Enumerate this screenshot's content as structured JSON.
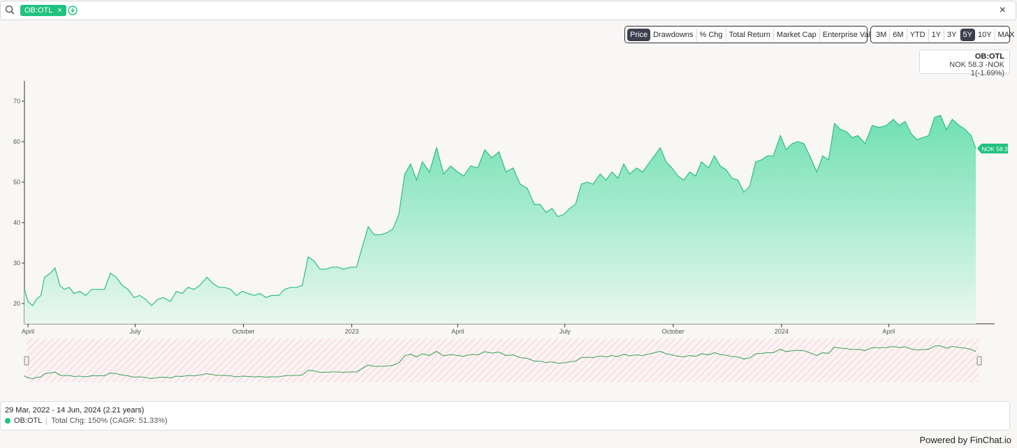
{
  "search": {
    "ticker_chip": "OB:OTL",
    "chip_close": "×",
    "close_symbol": "×"
  },
  "toolbar": {
    "metrics": [
      "Price",
      "Drawdowns",
      "% Chg",
      "Total Return",
      "Market Cap",
      "Enterprise Value"
    ],
    "active_metric": "Price",
    "ranges": [
      "3M",
      "6M",
      "YTD",
      "1Y",
      "3Y",
      "5Y",
      "10Y",
      "MAX"
    ],
    "active_range": "5Y"
  },
  "tooltip": {
    "ticker": "OB:OTL",
    "price_change": "NOK 58.3  -NOK 1(-1.69%)"
  },
  "footer": {
    "date_range": "29 Mar, 2022 - 14 Jun, 2024 (2.21 years)",
    "ticker": "OB:OTL",
    "total_change": "Total Chg: 150% (CAGR: 51.33%)"
  },
  "powered_by": "Powered by FinChat.io",
  "colors": {
    "accent": "#20c27f",
    "line": "#2dbf80",
    "area_top": "#6fe0b3",
    "area_bottom": "#e9f7f0",
    "navigator_hatch": "#f3c5cc"
  },
  "chart_data": {
    "type": "area",
    "series": [
      {
        "name": "OB:OTL"
      }
    ],
    "ylim": [
      15,
      75
    ],
    "yticks": [
      20,
      30,
      40,
      50,
      60,
      70
    ],
    "xlim": [
      "2022-03-29",
      "2024-06-14"
    ],
    "xticks": [
      {
        "date": "2022-04-01",
        "label": "April"
      },
      {
        "date": "2022-07-01",
        "label": "July"
      },
      {
        "date": "2022-10-01",
        "label": "October"
      },
      {
        "date": "2023-01-01",
        "label": "2023"
      },
      {
        "date": "2023-04-01",
        "label": "April"
      },
      {
        "date": "2023-07-01",
        "label": "July"
      },
      {
        "date": "2023-10-01",
        "label": "October"
      },
      {
        "date": "2024-01-01",
        "label": "2024"
      },
      {
        "date": "2024-04-01",
        "label": "April"
      }
    ],
    "last_label": "NOK 58.3",
    "points": [
      [
        "2022-03-29",
        23.5
      ],
      [
        "2022-04-01",
        20.5
      ],
      [
        "2022-04-05",
        19.5
      ],
      [
        "2022-04-08",
        21
      ],
      [
        "2022-04-12",
        22
      ],
      [
        "2022-04-15",
        26.5
      ],
      [
        "2022-04-20",
        27.5
      ],
      [
        "2022-04-24",
        28.8
      ],
      [
        "2022-04-28",
        24.5
      ],
      [
        "2022-05-02",
        23.5
      ],
      [
        "2022-05-06",
        24
      ],
      [
        "2022-05-10",
        22.5
      ],
      [
        "2022-05-15",
        23
      ],
      [
        "2022-05-20",
        22
      ],
      [
        "2022-05-25",
        23.5
      ],
      [
        "2022-05-31",
        23.5
      ],
      [
        "2022-06-05",
        23.5
      ],
      [
        "2022-06-10",
        27.5
      ],
      [
        "2022-06-15",
        26.5
      ],
      [
        "2022-06-20",
        24.5
      ],
      [
        "2022-06-25",
        23.5
      ],
      [
        "2022-06-30",
        21.5
      ],
      [
        "2022-07-05",
        22
      ],
      [
        "2022-07-10",
        21
      ],
      [
        "2022-07-15",
        19.5
      ],
      [
        "2022-07-20",
        21
      ],
      [
        "2022-07-25",
        21.5
      ],
      [
        "2022-07-31",
        20.5
      ],
      [
        "2022-08-05",
        23
      ],
      [
        "2022-08-10",
        22.5
      ],
      [
        "2022-08-15",
        24
      ],
      [
        "2022-08-20",
        23.5
      ],
      [
        "2022-08-25",
        24.5
      ],
      [
        "2022-08-31",
        26.5
      ],
      [
        "2022-09-05",
        25
      ],
      [
        "2022-09-10",
        24
      ],
      [
        "2022-09-15",
        24
      ],
      [
        "2022-09-20",
        23.5
      ],
      [
        "2022-09-25",
        22
      ],
      [
        "2022-09-30",
        23
      ],
      [
        "2022-10-05",
        22.5
      ],
      [
        "2022-10-10",
        22
      ],
      [
        "2022-10-15",
        22.5
      ],
      [
        "2022-10-20",
        21.5
      ],
      [
        "2022-10-25",
        22
      ],
      [
        "2022-10-31",
        22
      ],
      [
        "2022-11-05",
        23.5
      ],
      [
        "2022-11-10",
        24
      ],
      [
        "2022-11-15",
        24
      ],
      [
        "2022-11-20",
        24.5
      ],
      [
        "2022-11-25",
        31.5
      ],
      [
        "2022-11-30",
        30.5
      ],
      [
        "2022-12-05",
        28.5
      ],
      [
        "2022-12-10",
        28.5
      ],
      [
        "2022-12-15",
        29
      ],
      [
        "2022-12-20",
        29
      ],
      [
        "2022-12-25",
        28.5
      ],
      [
        "2022-12-31",
        29
      ],
      [
        "2023-01-05",
        29
      ],
      [
        "2023-01-10",
        34
      ],
      [
        "2023-01-15",
        39
      ],
      [
        "2023-01-20",
        37
      ],
      [
        "2023-01-25",
        37
      ],
      [
        "2023-01-31",
        37.5
      ],
      [
        "2023-02-05",
        38.5
      ],
      [
        "2023-02-10",
        42
      ],
      [
        "2023-02-15",
        52
      ],
      [
        "2023-02-20",
        54.5
      ],
      [
        "2023-02-25",
        50.5
      ],
      [
        "2023-03-02",
        55
      ],
      [
        "2023-03-08",
        52.5
      ],
      [
        "2023-03-14",
        58.5
      ],
      [
        "2023-03-20",
        52
      ],
      [
        "2023-03-26",
        54
      ],
      [
        "2023-04-01",
        52.5
      ],
      [
        "2023-04-06",
        51.5
      ],
      [
        "2023-04-12",
        54
      ],
      [
        "2023-04-18",
        53.5
      ],
      [
        "2023-04-24",
        58
      ],
      [
        "2023-04-30",
        56
      ],
      [
        "2023-05-06",
        57.5
      ],
      [
        "2023-05-12",
        52.5
      ],
      [
        "2023-05-18",
        53.5
      ],
      [
        "2023-05-24",
        49.5
      ],
      [
        "2023-05-30",
        48.5
      ],
      [
        "2023-06-05",
        44.5
      ],
      [
        "2023-06-10",
        44.5
      ],
      [
        "2023-06-15",
        42.5
      ],
      [
        "2023-06-20",
        43.5
      ],
      [
        "2023-06-25",
        41.5
      ],
      [
        "2023-06-30",
        42
      ],
      [
        "2023-07-05",
        43.5
      ],
      [
        "2023-07-10",
        44.5
      ],
      [
        "2023-07-15",
        49.5
      ],
      [
        "2023-07-20",
        50
      ],
      [
        "2023-07-25",
        49.5
      ],
      [
        "2023-07-31",
        52
      ],
      [
        "2023-08-05",
        50.5
      ],
      [
        "2023-08-10",
        52.5
      ],
      [
        "2023-08-15",
        51
      ],
      [
        "2023-08-20",
        54.5
      ],
      [
        "2023-08-25",
        52
      ],
      [
        "2023-08-31",
        53.5
      ],
      [
        "2023-09-05",
        52.5
      ],
      [
        "2023-09-10",
        54.5
      ],
      [
        "2023-09-15",
        56.5
      ],
      [
        "2023-09-20",
        58.5
      ],
      [
        "2023-09-25",
        55
      ],
      [
        "2023-09-30",
        53.5
      ],
      [
        "2023-10-05",
        51.5
      ],
      [
        "2023-10-10",
        50.5
      ],
      [
        "2023-10-15",
        52.5
      ],
      [
        "2023-10-20",
        51.5
      ],
      [
        "2023-10-25",
        55
      ],
      [
        "2023-10-31",
        53.5
      ],
      [
        "2023-11-05",
        56.5
      ],
      [
        "2023-11-10",
        54
      ],
      [
        "2023-11-15",
        53
      ],
      [
        "2023-11-20",
        51
      ],
      [
        "2023-11-25",
        50.5
      ],
      [
        "2023-11-30",
        47.5
      ],
      [
        "2023-12-05",
        49
      ],
      [
        "2023-12-10",
        55
      ],
      [
        "2023-12-15",
        55.5
      ],
      [
        "2023-12-20",
        56.5
      ],
      [
        "2023-12-25",
        56.5
      ],
      [
        "2023-12-31",
        61.5
      ],
      [
        "2024-01-05",
        58
      ],
      [
        "2024-01-10",
        59.5
      ],
      [
        "2024-01-15",
        60
      ],
      [
        "2024-01-20",
        59.5
      ],
      [
        "2024-01-25",
        56.5
      ],
      [
        "2024-01-31",
        52.5
      ],
      [
        "2024-02-05",
        56.5
      ],
      [
        "2024-02-10",
        55.5
      ],
      [
        "2024-02-15",
        64.5
      ],
      [
        "2024-02-20",
        63
      ],
      [
        "2024-02-25",
        62.5
      ],
      [
        "2024-03-01",
        61
      ],
      [
        "2024-03-06",
        61.5
      ],
      [
        "2024-03-12",
        59.5
      ],
      [
        "2024-03-18",
        64
      ],
      [
        "2024-03-24",
        63.5
      ],
      [
        "2024-03-30",
        64
      ],
      [
        "2024-04-05",
        65.5
      ],
      [
        "2024-04-10",
        64
      ],
      [
        "2024-04-15",
        65
      ],
      [
        "2024-04-20",
        62
      ],
      [
        "2024-04-25",
        60.5
      ],
      [
        "2024-04-30",
        61
      ],
      [
        "2024-05-05",
        61.5
      ],
      [
        "2024-05-10",
        66
      ],
      [
        "2024-05-15",
        66.5
      ],
      [
        "2024-05-20",
        63
      ],
      [
        "2024-05-25",
        65.5
      ],
      [
        "2024-05-31",
        64
      ],
      [
        "2024-06-05",
        63
      ],
      [
        "2024-06-10",
        61.5
      ],
      [
        "2024-06-14",
        58.3
      ]
    ]
  }
}
